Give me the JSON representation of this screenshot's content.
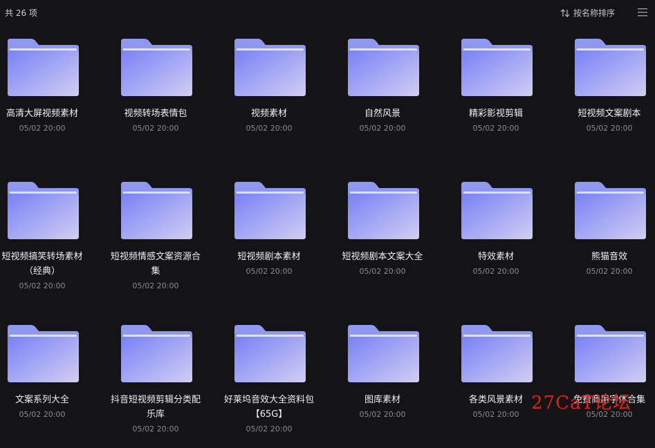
{
  "header": {
    "count": "共 26 项",
    "sort_label": "按名称排序"
  },
  "items": [
    {
      "name": "高清大屏视频素材",
      "date": "05/02 20:00"
    },
    {
      "name": "视频转场表情包",
      "date": "05/02 20:00"
    },
    {
      "name": "视频素材",
      "date": "05/02 20:00"
    },
    {
      "name": "自然风景",
      "date": "05/02 20:00"
    },
    {
      "name": "精彩影视剪辑",
      "date": "05/02 20:00"
    },
    {
      "name": "短视频文案剧本",
      "date": "05/02 20:00"
    },
    {
      "name": "短视频搞笑转场素材（经典）",
      "date": "05/02 20:00"
    },
    {
      "name": "短视频情感文案资源合集",
      "date": "05/02 20:00"
    },
    {
      "name": "短视频剧本素材",
      "date": "05/02 20:00"
    },
    {
      "name": "短视频剧本文案大全",
      "date": "05/02 20:00"
    },
    {
      "name": "特效素材",
      "date": "05/02 20:00"
    },
    {
      "name": "熊猫音效",
      "date": "05/02 20:00"
    },
    {
      "name": "文案系列大全",
      "date": "05/02 20:00"
    },
    {
      "name": "抖音短视频剪辑分类配乐库",
      "date": "05/02 20:00"
    },
    {
      "name": "好莱坞音效大全资料包【65G】",
      "date": "05/02 20:00"
    },
    {
      "name": "图库素材",
      "date": "05/02 20:00"
    },
    {
      "name": "各类风景素材",
      "date": "05/02 20:00"
    },
    {
      "name": "免费商用字体合集",
      "date": "05/02 20:00"
    }
  ],
  "watermark": "27CaT论坛",
  "colors": {
    "background": "#141417",
    "folder_front_start": "#7a86f8",
    "folder_front_end": "#d0cbf3",
    "folder_back": "#9aa2f2",
    "date_text": "#8a8a92"
  }
}
